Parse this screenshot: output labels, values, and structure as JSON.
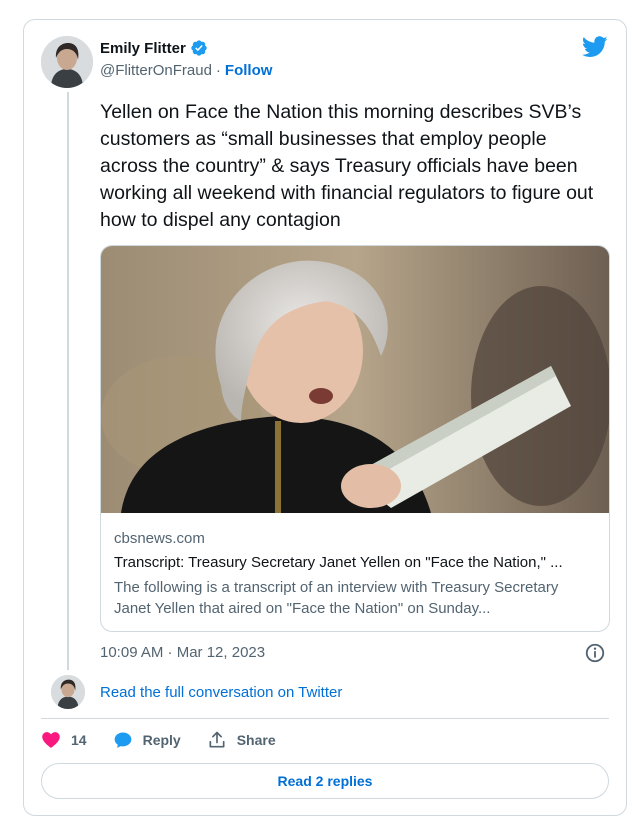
{
  "author": {
    "name": "Emily Flitter",
    "handle": "@FlitterOnFraud",
    "separator": "·",
    "follow_label": "Follow"
  },
  "tweet": {
    "text": "Yellen on Face the Nation this morning describes SVB’s customers as “small businesses that employ people across the country” & says Treasury officials have been working all weekend with financial regulators to figure out how to dispel any contagion",
    "timestamp": "10:09 AM · Mar 12, 2023"
  },
  "link_card": {
    "domain": "cbsnews.com",
    "title": "Transcript: Treasury Secretary Janet Yellen on \"Face the Nation,\" ...",
    "description": "The following is a transcript of an interview with Treasury Secretary Janet Yellen that aired on \"Face the Nation\" on Sunday..."
  },
  "conversation": {
    "label": "Read the full conversation on Twitter"
  },
  "actions": {
    "like_count": "14",
    "reply_label": "Reply",
    "share_label": "Share"
  },
  "replies": {
    "label": "Read 2 replies"
  },
  "colors": {
    "link_blue": "#006fd6",
    "like_pink": "#f91880",
    "twitter_blue": "#1d9bf0",
    "muted_text": "#536471",
    "border": "#cfd9de"
  },
  "icons": [
    "verified-badge-icon",
    "twitter-bird-icon",
    "info-icon",
    "heart-icon",
    "reply-bubble-icon",
    "share-icon"
  ]
}
